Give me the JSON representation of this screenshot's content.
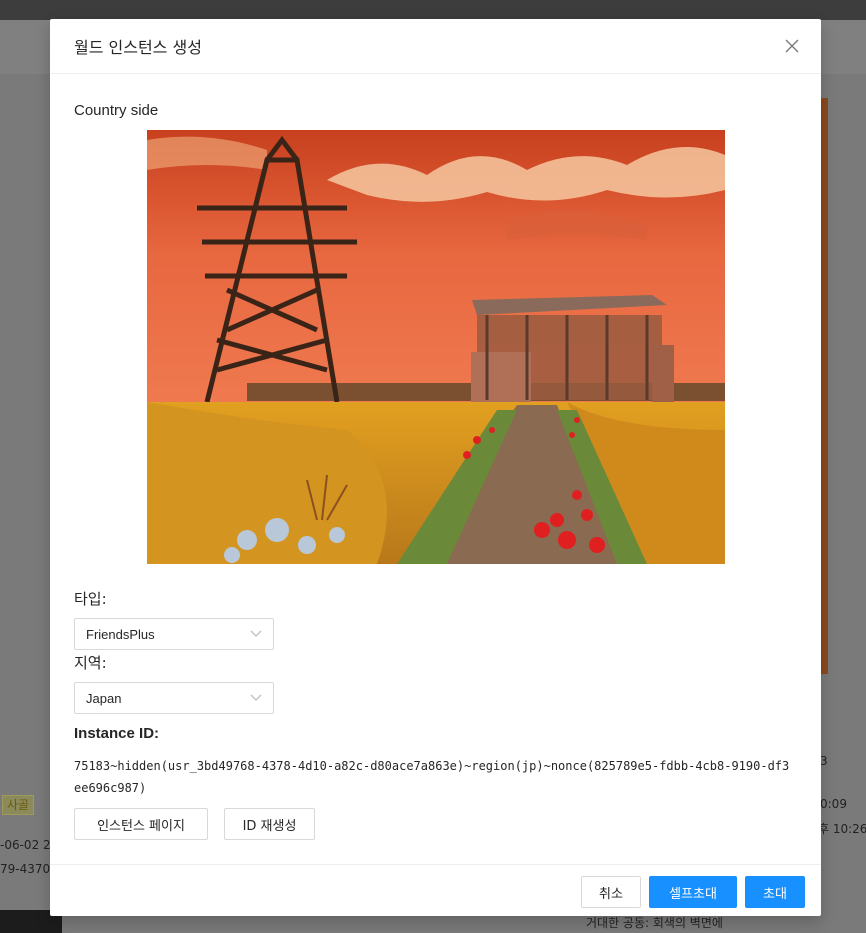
{
  "background": {
    "tag_label": "사골",
    "left_lines": [
      "-06-02 2",
      "79-4370-"
    ],
    "right_lines": [
      "3",
      "0:09",
      "후 10:26"
    ],
    "bottom_text": "거대한 공동: 회색의 벽면에"
  },
  "modal": {
    "title": "월드 인스턴스 생성",
    "close_icon": "close-icon",
    "world_name": "Country side",
    "type_label": "타입:",
    "type_value": "FriendsPlus",
    "region_label": "지역:",
    "region_value": "Japan",
    "instance_label": "Instance ID:",
    "instance_id": "75183~hidden(usr_3bd49768-4378-4d10-a82c-d80ace7a863e)~region(jp)~nonce(825789e5-fdbb-4cb8-9190-df3ee696c987)",
    "instance_page_button": "인스턴스 페이지",
    "regenerate_id_button": "ID 재생성",
    "cancel_button": "취소",
    "self_invite_button": "셀프초대",
    "invite_button": "초대"
  },
  "colors": {
    "primary": "#1890ff",
    "mask": "#7a7a7a"
  }
}
